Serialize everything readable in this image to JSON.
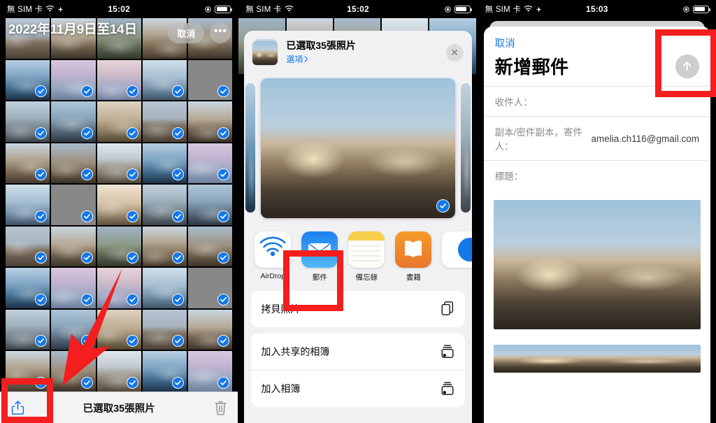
{
  "panel1": {
    "status": {
      "carrier": "無 SIM 卡",
      "time": "15:02"
    },
    "album_title": "2022年11月9日至14日",
    "cancel_label": "取消",
    "more_label": "•••",
    "bottom_label": "已選取35張照片",
    "share_icon": "share-up-icon",
    "trash_icon": "trash-icon",
    "selected_count": 35,
    "grid": {
      "columns": 5,
      "rows": 9,
      "all_selected": true
    }
  },
  "panel2": {
    "status": {
      "carrier": "無 SIM 卡",
      "time": "15:02"
    },
    "sheet": {
      "title": "已選取35張照片",
      "options_label": "選項",
      "options_chevron": "chevron-right-icon",
      "close_icon": "close-icon"
    },
    "apps": [
      {
        "label": "AirDrop",
        "icon": "airdrop-icon"
      },
      {
        "label": "郵件",
        "icon": "mail-icon",
        "highlighted": true
      },
      {
        "label": "備忘錄",
        "icon": "notes-icon"
      },
      {
        "label": "書籍",
        "icon": "books-icon"
      },
      {
        "label": "",
        "icon": "partial-app-icon"
      }
    ],
    "actions": [
      {
        "label": "拷貝照片",
        "icon": "copy-icon"
      },
      {
        "label": "加入共享的相簿",
        "icon": "shared-album-icon"
      },
      {
        "label": "加入相簿",
        "icon": "album-icon"
      }
    ]
  },
  "panel3": {
    "status": {
      "carrier": "無 SIM 卡",
      "time": "15:03"
    },
    "cancel_label": "取消",
    "title": "新增郵件",
    "send_icon": "send-up-arrow-icon",
    "fields": [
      {
        "label": "收件人：",
        "value": ""
      },
      {
        "label": "副本/密件副本，寄件人：",
        "value": "amelia.ch116@gmail.com"
      },
      {
        "label": "標題：",
        "value": ""
      }
    ]
  },
  "annotations": {
    "accent_color": "#f41e1e",
    "share_button_box": "highlight-share-button",
    "mail_app_box": "highlight-mail-app",
    "send_button_box": "highlight-send-button",
    "arrow": "red-arrow-pointing-to-share-button"
  }
}
